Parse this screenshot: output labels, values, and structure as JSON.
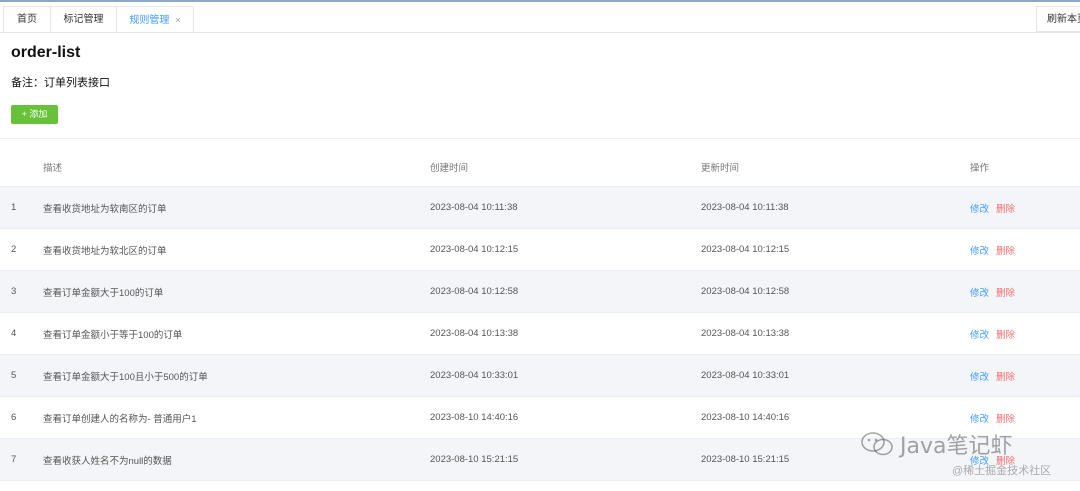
{
  "tabs": [
    {
      "label": "首页",
      "active": false
    },
    {
      "label": "标记管理",
      "active": false
    },
    {
      "label": "规则管理",
      "active": true,
      "close": "×"
    }
  ],
  "refresh_label": "刷新本页",
  "page": {
    "title": "order-list",
    "remark": "备注：订单列表接口",
    "add_button": "+ 添加"
  },
  "table": {
    "headers": {
      "desc": "描述",
      "created": "创建时间",
      "updated": "更新时间",
      "ops": "操作"
    },
    "edit_label": "修改",
    "delete_label": "删除",
    "rows": [
      {
        "idx": "1",
        "desc": "查看收货地址为软南区的订单",
        "created": "2023-08-04 10:11:38",
        "updated": "2023-08-04 10:11:38"
      },
      {
        "idx": "2",
        "desc": "查看收货地址为软北区的订单",
        "created": "2023-08-04 10:12:15",
        "updated": "2023-08-04 10:12:15"
      },
      {
        "idx": "3",
        "desc": "查看订单金额大于100的订单",
        "created": "2023-08-04 10:12:58",
        "updated": "2023-08-04 10:12:58"
      },
      {
        "idx": "4",
        "desc": "查看订单金额小于等于100的订单",
        "created": "2023-08-04 10:13:38",
        "updated": "2023-08-04 10:13:38"
      },
      {
        "idx": "5",
        "desc": "查看订单金额大于100且小于500的订单",
        "created": "2023-08-04 10:33:01",
        "updated": "2023-08-04 10:33:01"
      },
      {
        "idx": "6",
        "desc": "查看订单创建人的名称为- 普通用户1",
        "created": "2023-08-10 14:40:16",
        "updated": "2023-08-10 14:40:16"
      },
      {
        "idx": "7",
        "desc": "查看收获人姓名不为null的数据",
        "created": "2023-08-10 15:21:15",
        "updated": "2023-08-10 15:21:15"
      }
    ]
  },
  "watermark": {
    "main": "Java笔记虾",
    "sub": "@稀土掘金技术社区",
    "icon": "wechat-icon"
  }
}
